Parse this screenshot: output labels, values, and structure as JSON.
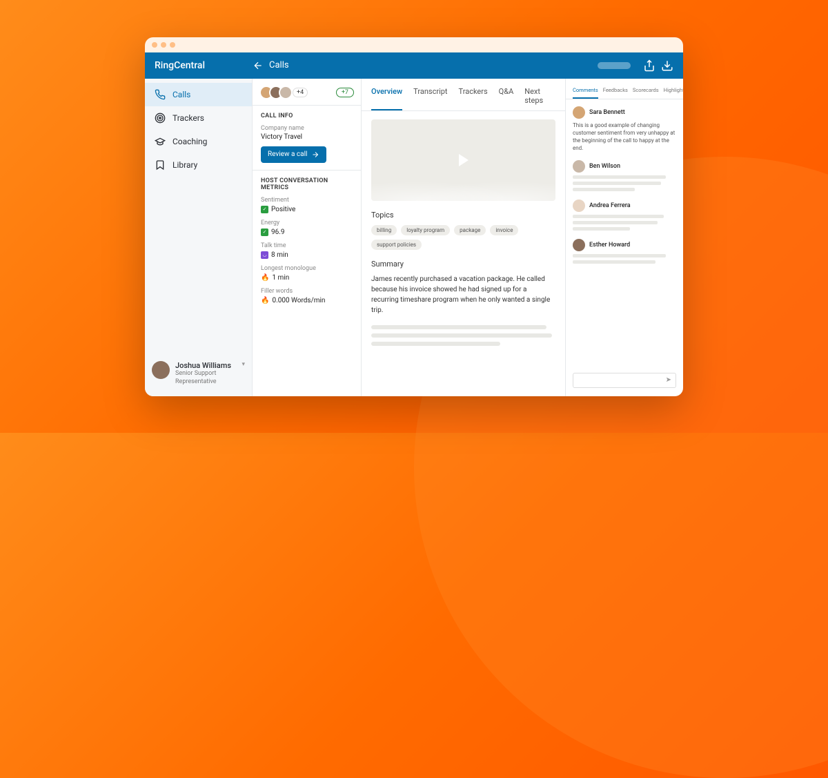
{
  "brand": "RingCentral",
  "header": {
    "page_title": "Calls"
  },
  "sidebar": {
    "items": [
      {
        "label": "Calls",
        "icon": "phone-icon",
        "active": true
      },
      {
        "label": "Trackers",
        "icon": "target-icon"
      },
      {
        "label": "Coaching",
        "icon": "graduation-icon"
      },
      {
        "label": "Library",
        "icon": "bookmark-icon"
      }
    ]
  },
  "user": {
    "name": "Joshua Williams",
    "role": "Senior Support Representative"
  },
  "avatars": {
    "extra_count": "+4",
    "plus_badge": "+7"
  },
  "call_info": {
    "title": "CALL INFO",
    "company_label": "Company name",
    "company_value": "Victory Travel",
    "review_button": "Review a call"
  },
  "metrics": {
    "title": "HOST CONVERSATION METRICS",
    "items": [
      {
        "label": "Sentiment",
        "value": "Positive",
        "badge": "green-check"
      },
      {
        "label": "Energy",
        "value": "96.9",
        "badge": "green-check"
      },
      {
        "label": "Talk time",
        "value": "8 min",
        "badge": "purple"
      },
      {
        "label": "Longest monologue",
        "value": "1 min",
        "badge": "fire"
      },
      {
        "label": "Filler words",
        "value": "0.000 Words/min",
        "badge": "fire"
      }
    ]
  },
  "tabs": [
    "Overview",
    "Transcript",
    "Trackers",
    "Q&A",
    "Next steps"
  ],
  "topics": {
    "heading": "Topics",
    "items": [
      "billing",
      "loyalty program",
      "package",
      "invoice",
      "support policies"
    ]
  },
  "summary": {
    "heading": "Summary",
    "text": "James recently purchased a vacation package. He called because his invoice showed he had signed up for a recurring timeshare program when he only wanted a single trip."
  },
  "side_tabs": [
    "Comments",
    "Feedbacks",
    "Scorecards",
    "Highlights"
  ],
  "comments": [
    {
      "name": "Sara Bennett",
      "text": "This is a good example of changing customer sentiment from very unhappy at the beginning of the call to happy at the end.",
      "color": "#d4a574"
    },
    {
      "name": "Ben Wilson",
      "text": "",
      "color": "#c9b8a8"
    },
    {
      "name": "Andrea Ferrera",
      "text": "",
      "color": "#e8d5c4"
    },
    {
      "name": "Esther Howard",
      "text": "",
      "color": "#8b6f5c"
    }
  ]
}
